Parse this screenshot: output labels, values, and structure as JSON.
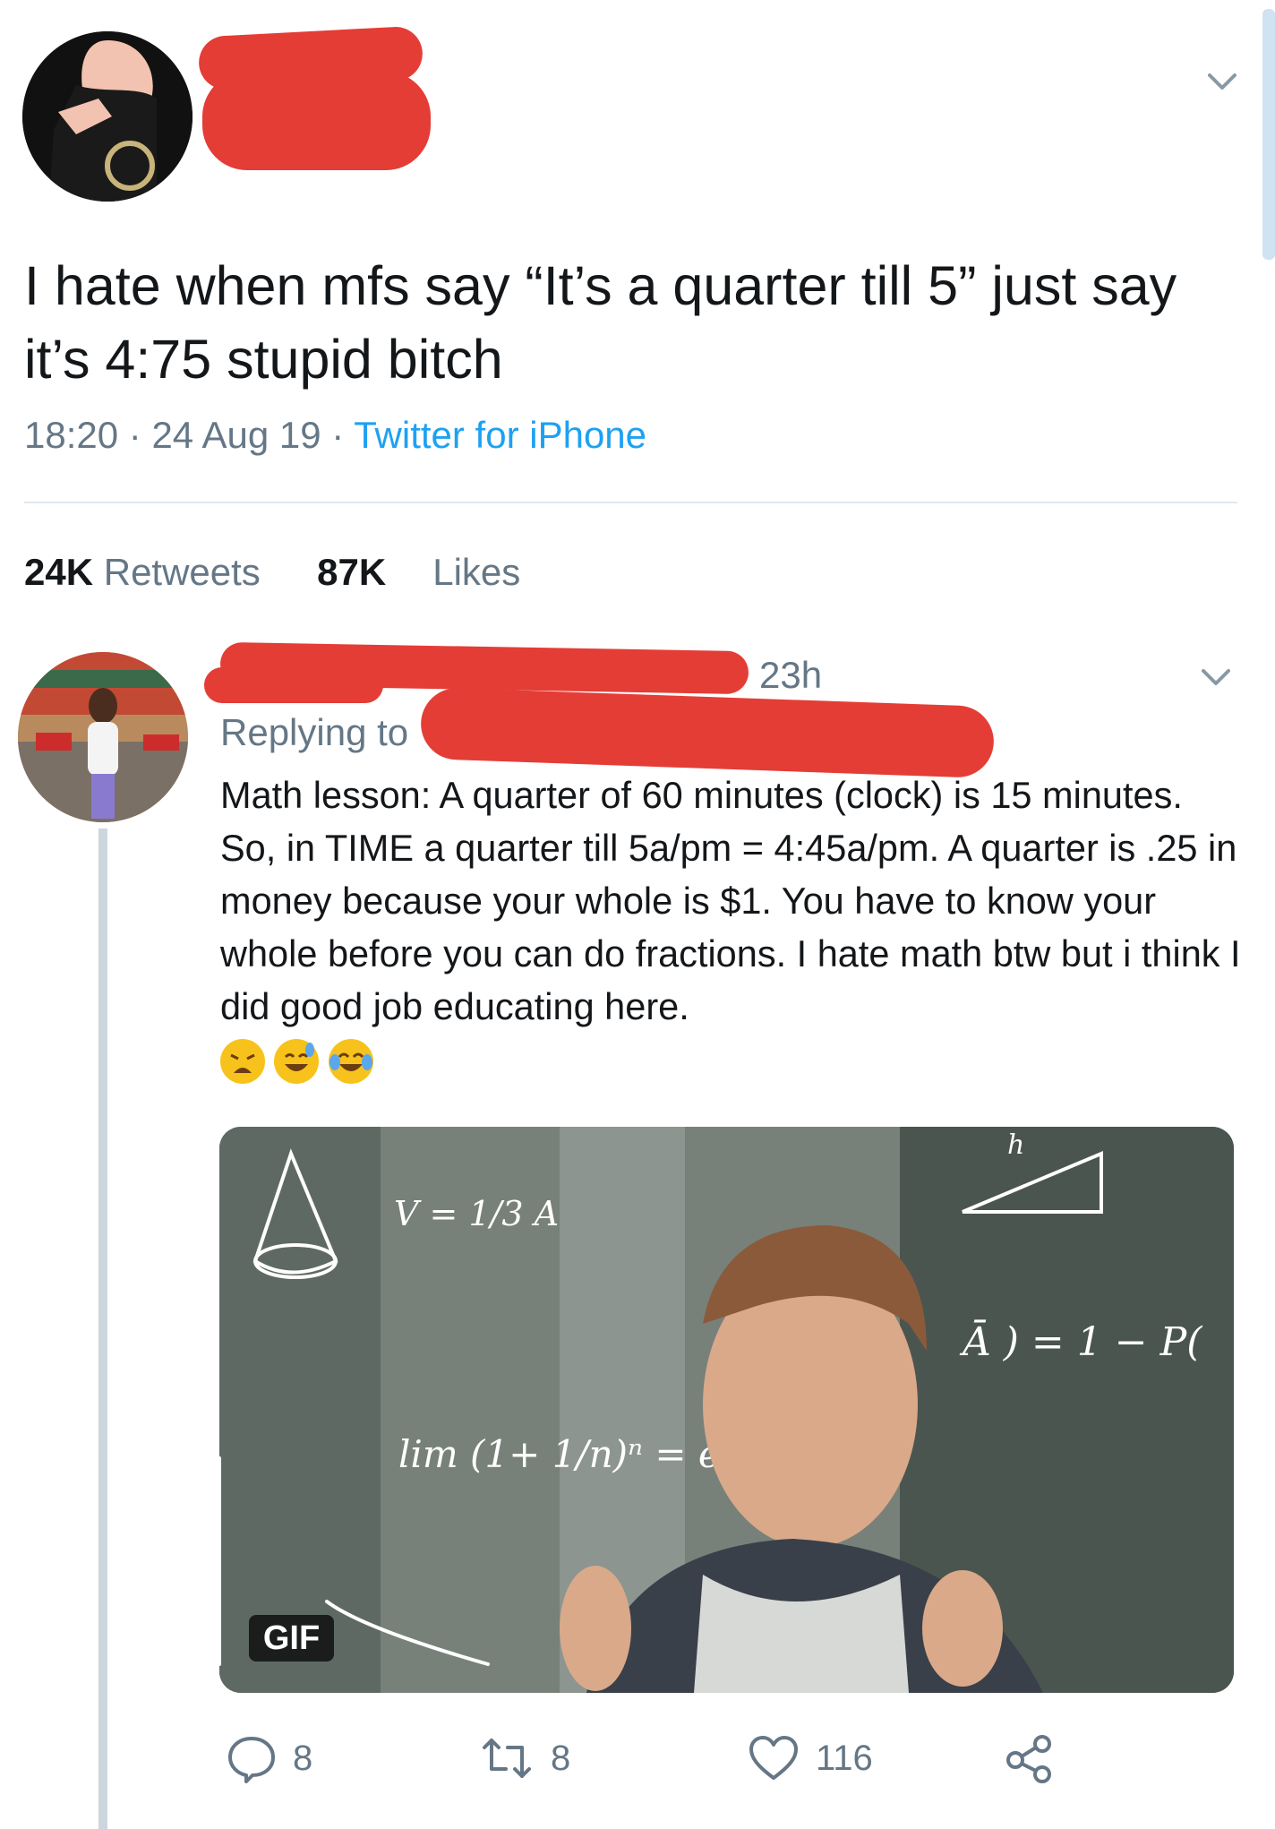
{
  "tweet": {
    "text": "I hate when mfs say “It’s a quarter till 5” just say it’s 4:75 stupid bitch",
    "time": "18:20",
    "date": "24 Aug 19",
    "source": "Twitter for iPhone",
    "retweets_count": "24K",
    "retweets_label": "Retweets",
    "likes_count": "87K",
    "likes_label": "Likes"
  },
  "reply": {
    "age": "23h",
    "replying_to_label": "Replying to",
    "text": "Math lesson: A quarter of 60 minutes (clock) is 15 minutes. So, in TIME a quarter till 5a/pm = 4:45a/pm. A quarter is .25 in money because your whole is $1. You have to know your whole before you can do fractions. I hate math btw but i think I did good job educating here.",
    "media_badge": "GIF",
    "formulas": {
      "cone": "V = 1/3 A",
      "limit": "lim (1+ 1/n)ⁿ = e",
      "prob": "Ā ) = 1 − P(",
      "tri_top": "h"
    },
    "actions": {
      "replies": "8",
      "retweets": "8",
      "likes": "116"
    }
  },
  "colors": {
    "link": "#1da1f2",
    "muted": "#657786",
    "redaction": "#e43d36"
  }
}
